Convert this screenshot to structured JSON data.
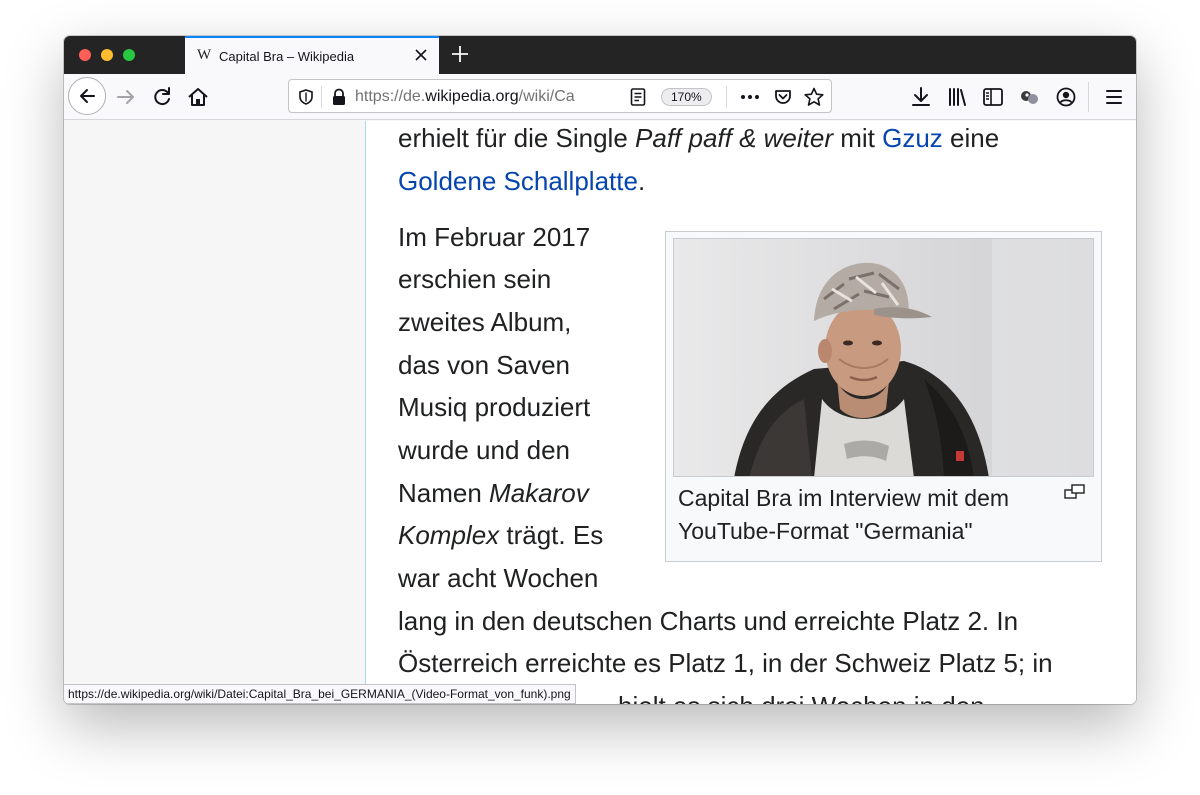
{
  "browser": {
    "tab": {
      "favicon": "W",
      "title": "Capital Bra – Wikipedia"
    },
    "url": {
      "prefix": "https://de.",
      "host": "wikipedia.org",
      "path": "/wiki/Ca"
    },
    "zoom": "170%",
    "icons": {
      "close": "close-icon",
      "new_tab": "plus-icon",
      "back": "back-arrow-icon",
      "forward": "forward-arrow-icon",
      "reload": "reload-icon",
      "home": "home-icon",
      "tracking": "shield-icon",
      "lock": "lock-icon",
      "reader": "reader-view-icon",
      "more": "ellipsis-icon",
      "pocket": "pocket-icon",
      "bookmark": "star-icon",
      "downloads": "download-icon",
      "library": "library-icon",
      "sidebar": "sidebar-icon",
      "extensions": "extension-icon",
      "account": "account-icon",
      "menu": "hamburger-menu-icon"
    }
  },
  "article": {
    "line1": {
      "before": "erhielt für die Single ",
      "italic": "Paff paff & weiter",
      "middle": " mit ",
      "link": "Gzuz",
      "after": " eine"
    },
    "line2": {
      "link": "Goldene Schallplatte",
      "after": "."
    },
    "narrow_lines": [
      "Im Februar 2017",
      "erschien sein",
      "zweites Album,",
      "das von Saven",
      "Musiq produziert",
      "wurde und den"
    ],
    "line_namen": {
      "before": "Namen ",
      "italic": "Makarov"
    },
    "line_komplex": {
      "italic": "Komplex",
      "after": " trägt. Es"
    },
    "line_war": "war acht Wochen",
    "line_lang": "lang in den deutschen Charts und erreichte Platz 2. In",
    "line_oesterreich": "Österreich erreichte es Platz 1, in der Schweiz Platz 5; in",
    "line_partial": "hielt es sich drei Wochen in den",
    "figure": {
      "caption_line1": "Capital Bra im Interview mit dem",
      "caption_line2": "YouTube-Format \"Germania\""
    }
  },
  "status": {
    "url": "https://de.wikipedia.org/wiki/Datei:Capital_Bra_bei_GERMANIA_(Video-Format_von_funk).png"
  },
  "colors": {
    "link": "#0645ad",
    "tab_accent": "#0a84ff",
    "article_border": "#a7d7f9"
  }
}
